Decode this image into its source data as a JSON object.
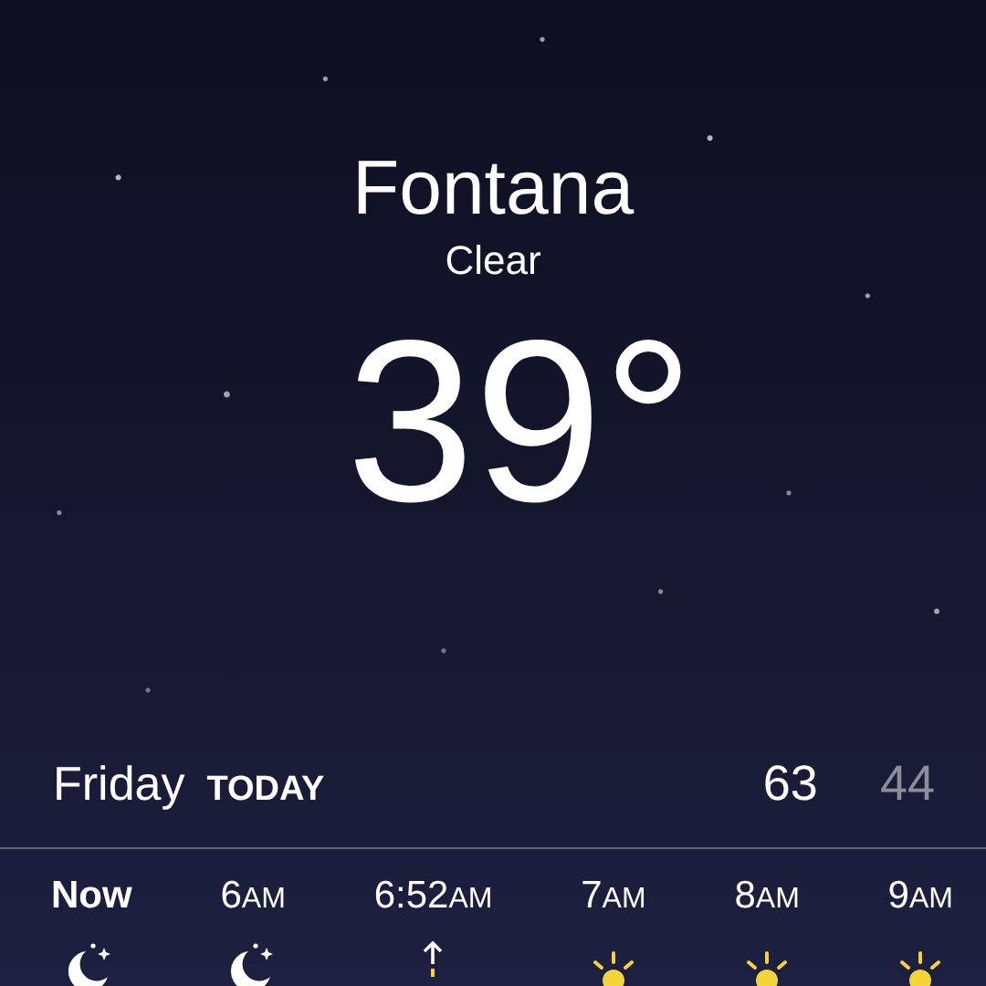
{
  "location": {
    "city": "Fontana",
    "condition": "Clear",
    "temperature": "39°"
  },
  "today": {
    "day": "Friday",
    "label": "TODAY",
    "high": "63",
    "low": "44"
  },
  "hourly": [
    {
      "hour": "Now",
      "bold": true,
      "kind": "moon"
    },
    {
      "hour": "6",
      "period": "AM",
      "bold": false,
      "kind": "moon"
    },
    {
      "hour": "6:52",
      "period": "AM",
      "bold": false,
      "kind": "sunrise"
    },
    {
      "hour": "7",
      "period": "AM",
      "bold": false,
      "kind": "sun"
    },
    {
      "hour": "8",
      "period": "AM",
      "bold": false,
      "kind": "sun"
    },
    {
      "hour": "9",
      "period": "AM",
      "bold": false,
      "kind": "sun"
    }
  ]
}
